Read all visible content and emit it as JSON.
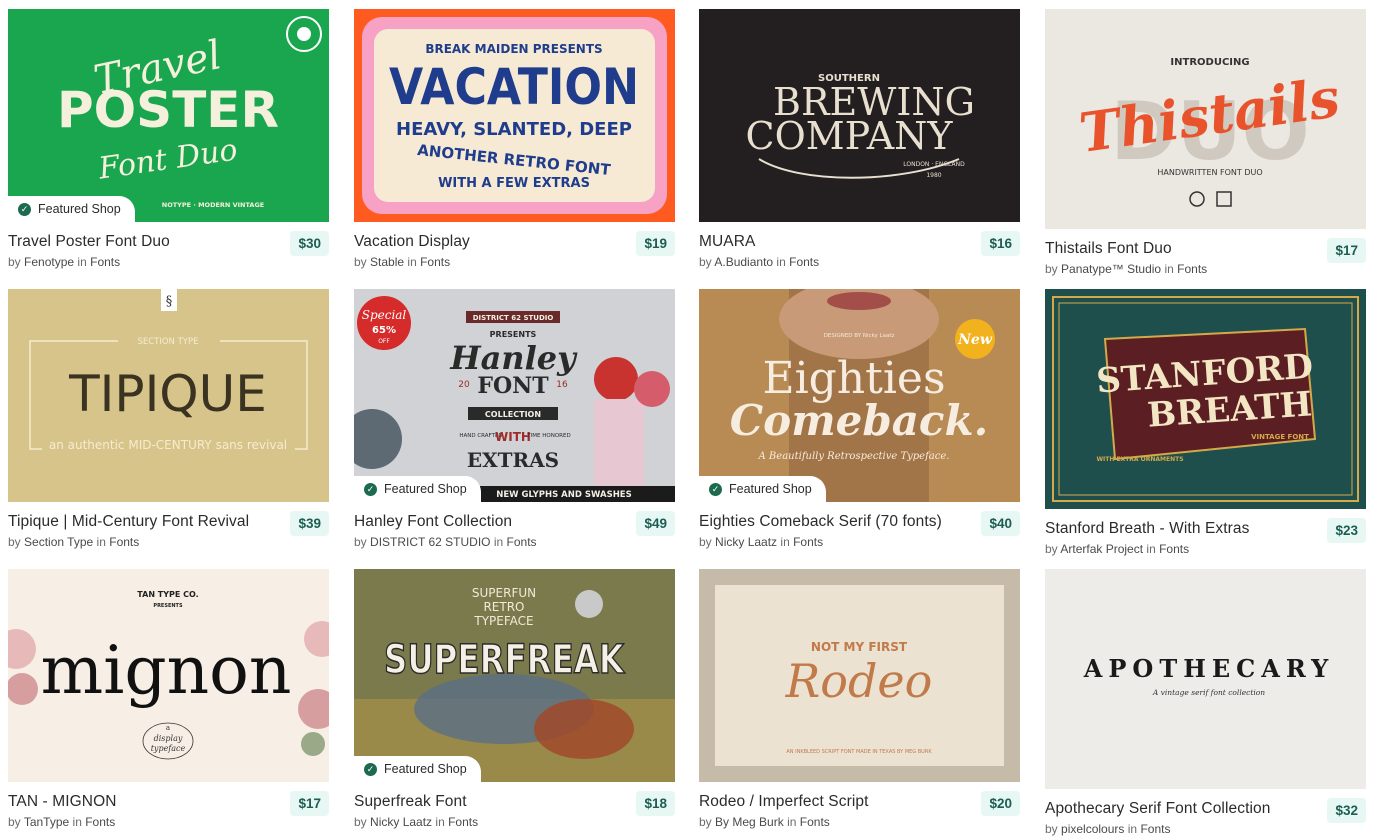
{
  "in_label": "in",
  "by_label": "by",
  "featured_label": "Featured Shop",
  "products": [
    {
      "title": "Travel Poster Font Duo",
      "author": "Fenotype",
      "category": "Fonts",
      "price": "$30",
      "featured": true
    },
    {
      "title": "Vacation Display",
      "author": "Stable",
      "category": "Fonts",
      "price": "$19",
      "featured": false
    },
    {
      "title": "MUARA",
      "author": "A.Budianto",
      "category": "Fonts",
      "price": "$16",
      "featured": false
    },
    {
      "title": "Thistails Font Duo",
      "author": "Panatype™ Studio",
      "category": "Fonts",
      "price": "$17",
      "featured": false
    },
    {
      "title": "Tipique | Mid-Century Font Revival",
      "author": "Section Type",
      "category": "Fonts",
      "price": "$39",
      "featured": false
    },
    {
      "title": "Hanley Font Collection",
      "author": "DISTRICT 62 STUDIO",
      "category": "Fonts",
      "price": "$49",
      "featured": true
    },
    {
      "title": "Eighties Comeback Serif (70 fonts)",
      "author": "Nicky Laatz",
      "category": "Fonts",
      "price": "$40",
      "featured": true
    },
    {
      "title": "Stanford Breath - With Extras",
      "author": "Arterfak Project",
      "category": "Fonts",
      "price": "$23",
      "featured": false
    },
    {
      "title": "TAN - MIGNON",
      "author": "TanType",
      "category": "Fonts",
      "price": "$17",
      "featured": false
    },
    {
      "title": "Superfreak Font",
      "author": "Nicky Laatz",
      "category": "Fonts",
      "price": "$18",
      "featured": true
    },
    {
      "title": "Rodeo / Imperfect Script",
      "author": "By Meg Burk",
      "category": "Fonts",
      "price": "$20",
      "featured": false
    },
    {
      "title": "Apothecary Serif Font Collection",
      "author": "pixelcolours",
      "category": "Fonts",
      "price": "$32",
      "featured": false
    }
  ],
  "art": {
    "travel": {
      "script1": "Travel",
      "big": "POSTER",
      "script2": "Font Duo",
      "small": "NOTYPE · MODERN VINTAGE",
      "bg": "#1aa64f"
    },
    "vacation": {
      "top": "BREAK MAIDEN PRESENTS",
      "big": "VACATION",
      "line2": "HEAVY, SLANTED, DEEP",
      "line3": "ANOTHER RETRO FONT",
      "line4": "WITH A FEW EXTRAS",
      "bg": "#ff5a1f"
    },
    "muara": {
      "small": "SOUTHERN",
      "line1": "BREWING",
      "line2": "COMPANY",
      "tag": "LONDON · ENGLAND",
      "year": "1980",
      "bg": "#231f20"
    },
    "thistails": {
      "small": "INTRODUCING",
      "script": "Thistails",
      "ghost": "DUO",
      "sub": "HANDWRITTEN FONT DUO",
      "bg": "#ebe7e1"
    },
    "tipique": {
      "small": "SECTION TYPE",
      "big": "TIPIQUE",
      "sub": "an authentic MID-CENTURY sans revival",
      "mark": "§",
      "bg": "#d6c48a"
    },
    "hanley": {
      "presents": "PRESENTS",
      "studio": "DISTRICT 62 STUDIO",
      "special": "Special",
      "pct": "65%",
      "off": "OFF",
      "script": "Hanley",
      "font": "FONT",
      "collection": "COLLECTION",
      "with": "WITH",
      "extras": "EXTRAS",
      "bottom": "NEW GLYPHS AND SWASHES",
      "y1": "20",
      "y2": "16",
      "hand": "HAND CRAFTED",
      "time": "TIME HONORED"
    },
    "eighties": {
      "line1": "Eighties",
      "line2": "Comeback.",
      "sub": "A Beautifully Retrospective Typeface.",
      "new": "New",
      "designer": "DESIGNED BY Nicky Laatz"
    },
    "stanford": {
      "line1": "STANFORD",
      "line2": "BREATH",
      "sub": "VINTAGE FONT",
      "extra": "WITH EXTRA ORNAMENTS",
      "bg": "#1f4f4d"
    },
    "mignon": {
      "top": "TAN TYPE CO.",
      "presents": "PRESENTS",
      "big": "mignon",
      "sub1": "a",
      "sub2": "display",
      "sub3": "typeface",
      "bg": "#f7efe6"
    },
    "superfreak": {
      "top1": "SUPERFUN",
      "top2": "RETRO",
      "top3": "TYPEFACE",
      "big": "SUPERFREAK",
      "bg": "#7b7a4d"
    },
    "rodeo": {
      "small": "NOT MY FIRST",
      "script": "Rodeo",
      "sub": "AN INKBLEED SCRIPT FONT MADE IN TEXAS BY MEG BURK",
      "bg": "#c5bba8"
    },
    "apothecary": {
      "big": "APOTHECARY",
      "sub": "A vintage serif font collection",
      "bg": "#eeece9"
    }
  }
}
